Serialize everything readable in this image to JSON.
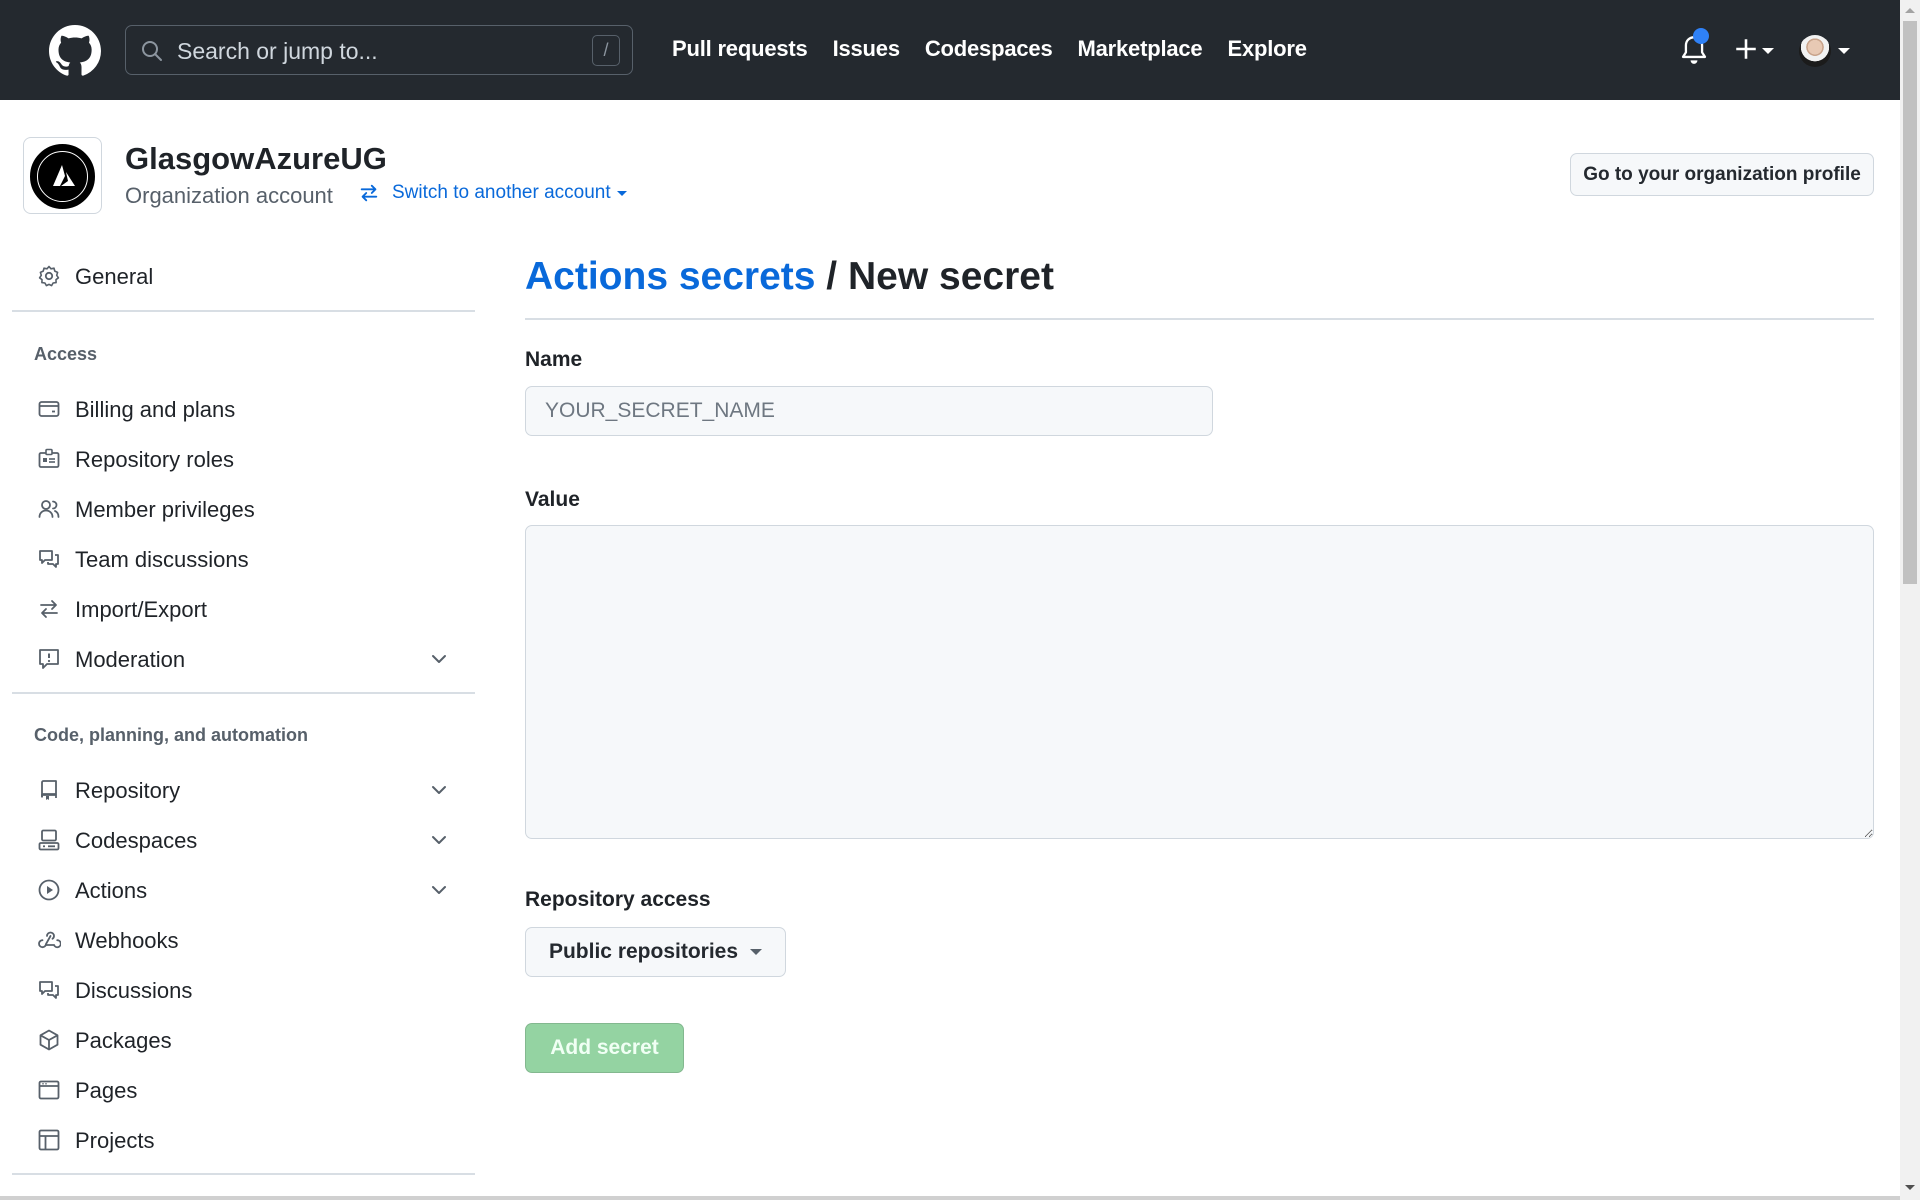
{
  "header": {
    "search_placeholder": "Search or jump to...",
    "search_shortcut": "/",
    "nav": [
      "Pull requests",
      "Issues",
      "Codespaces",
      "Marketplace",
      "Explore"
    ],
    "notification_indicator_color": "#2f81f7"
  },
  "org": {
    "name": "GlasgowAzureUG",
    "type": "Organization account",
    "switch_label": "Switch to another account",
    "profile_button": "Go to your organization profile"
  },
  "sidebar": {
    "general": {
      "label": "General",
      "icon": "gear-icon"
    },
    "sections": [
      {
        "heading": "Access",
        "items": [
          {
            "label": "Billing and plans",
            "icon": "credit-card-icon",
            "expandable": false
          },
          {
            "label": "Repository roles",
            "icon": "id-badge-icon",
            "expandable": false
          },
          {
            "label": "Member privileges",
            "icon": "people-icon",
            "expandable": false
          },
          {
            "label": "Team discussions",
            "icon": "comment-discussion-icon",
            "expandable": false
          },
          {
            "label": "Import/Export",
            "icon": "arrow-switch-icon",
            "expandable": false
          },
          {
            "label": "Moderation",
            "icon": "report-icon",
            "expandable": true
          }
        ]
      },
      {
        "heading": "Code, planning, and automation",
        "items": [
          {
            "label": "Repository",
            "icon": "repo-icon",
            "expandable": true
          },
          {
            "label": "Codespaces",
            "icon": "codespaces-icon",
            "expandable": true
          },
          {
            "label": "Actions",
            "icon": "play-icon",
            "expandable": true
          },
          {
            "label": "Webhooks",
            "icon": "webhook-icon",
            "expandable": false
          },
          {
            "label": "Discussions",
            "icon": "comment-discussion-icon",
            "expandable": false
          },
          {
            "label": "Packages",
            "icon": "package-icon",
            "expandable": false
          },
          {
            "label": "Pages",
            "icon": "browser-icon",
            "expandable": false
          },
          {
            "label": "Projects",
            "icon": "table-icon",
            "expandable": false
          }
        ]
      }
    ]
  },
  "main": {
    "breadcrumb_link": "Actions secrets",
    "breadcrumb_separator": " / ",
    "title": "New secret",
    "name_label": "Name",
    "name_placeholder": "YOUR_SECRET_NAME",
    "name_value": "",
    "value_label": "Value",
    "value_value": "",
    "access_label": "Repository access",
    "access_selected": "Public repositories",
    "submit_label": "Add secret",
    "submit_disabled": true,
    "submit_color": "#94d3a2"
  }
}
